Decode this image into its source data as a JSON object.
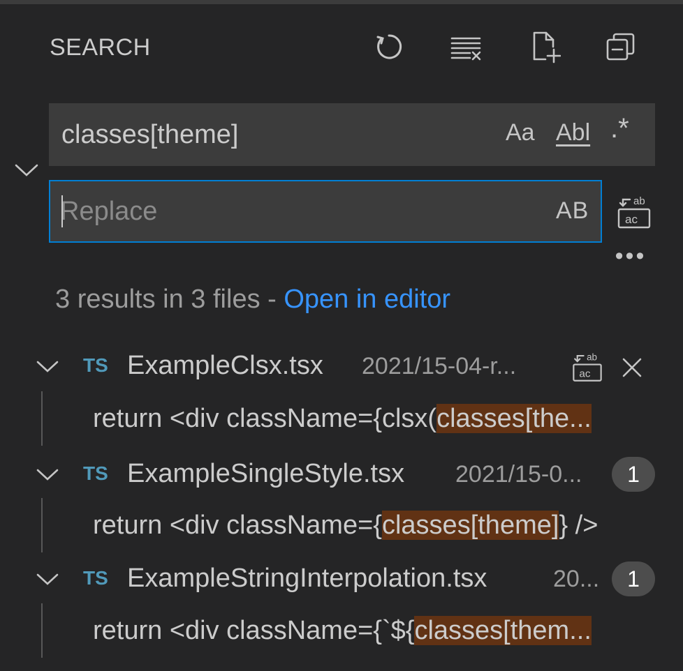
{
  "header": {
    "title": "SEARCH",
    "actions": [
      "refresh-icon",
      "clear-results-icon",
      "new-search-editor-icon",
      "collapse-all-icon"
    ]
  },
  "search": {
    "query": "classes[theme]",
    "match_case": "Aa",
    "whole_word": "Abl",
    "regex": ".*"
  },
  "replace": {
    "placeholder": "Replace",
    "value": "",
    "preserve_case": "AB"
  },
  "summary": {
    "text": "3 results in 3 files - ",
    "link": "Open in editor"
  },
  "results": [
    {
      "lang": "TS",
      "filename": "ExampleClsx.tsx",
      "path": "2021/15-04-r...",
      "count": "",
      "hovered": true,
      "match": {
        "before": "return <div className={clsx(",
        "highlight": "classes[the...",
        "after": ""
      }
    },
    {
      "lang": "TS",
      "filename": "ExampleSingleStyle.tsx",
      "path": "2021/15-0...",
      "count": "1",
      "hovered": false,
      "match": {
        "before": "return <div className={",
        "highlight": "classes[theme]",
        "after": "} />"
      }
    },
    {
      "lang": "TS",
      "filename": "ExampleStringInterpolation.tsx",
      "path": "20...",
      "count": "1",
      "hovered": false,
      "match": {
        "before": "return <div className={`${",
        "highlight": "classes[them...",
        "after": ""
      }
    }
  ],
  "colors": {
    "background": "#252526",
    "input": "#3c3c3c",
    "focus_border": "#007fd4",
    "link": "#3794ff",
    "ts_icon": "#519aba",
    "match_highlight": "#613214",
    "badge": "#4d4d4d"
  }
}
